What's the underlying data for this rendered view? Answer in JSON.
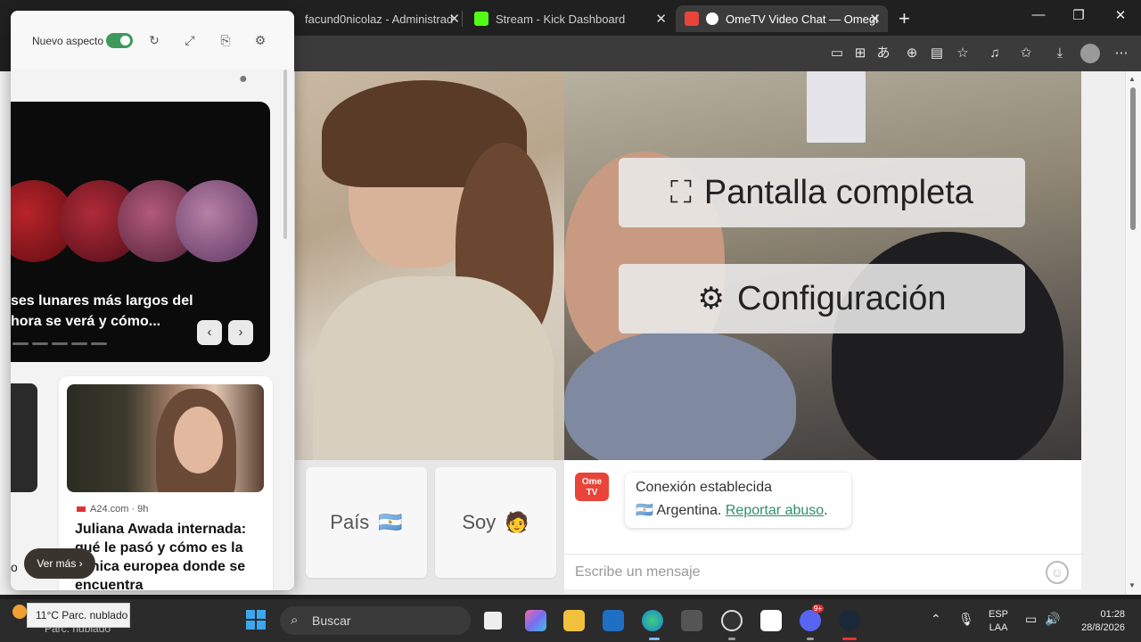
{
  "browser": {
    "tabs": [
      {
        "title": "facund0nicolaz - Administrad",
        "active": false
      },
      {
        "title": "Stream - Kick Dashboard",
        "active": false
      },
      {
        "title": "OmeTV Video Chat — Omegl",
        "active": true
      }
    ],
    "new_tab_label": "+",
    "window_controls": {
      "minimize": "—",
      "restore": "❐",
      "close": "✕"
    }
  },
  "sidebar": {
    "toggle_label": "Nuevo aspecto",
    "toggle_on": true,
    "header_icons": [
      "refresh-icon",
      "expand-icon",
      "share-icon",
      "gear-icon"
    ],
    "hero": {
      "title_line1": "ses lunares más largos del",
      "title_line2": "hora se verá y cómo...",
      "prev": "‹",
      "next": "›"
    },
    "news_card": {
      "source": "A24.com · 9h",
      "title": "Juliana Awada internada: qué le pasó y cómo es la clínica europea donde se encuentra"
    },
    "ver_mas": "Ver más",
    "side_letter": "o"
  },
  "video": {
    "fullscreen_label": "Pantalla completa",
    "settings_label": "Configuración"
  },
  "filters": {
    "country_label": "País",
    "country_flag": "🇦🇷",
    "gender_label": "Soy",
    "gender_emoji": "🧑"
  },
  "chat": {
    "logo_line1": "Ome",
    "logo_line2": "TV",
    "status": "Conexión establecida",
    "country_flag": "🇦🇷",
    "country": "Argentina.",
    "report_link": "Reportar abuso",
    "report_end": ".",
    "input_placeholder": "Escribe un mensaje"
  },
  "taskbar": {
    "weather_text": "Parc. nublado",
    "weather_tooltip": "11°C Parc. nublado",
    "search_placeholder": "Buscar",
    "notification_badge": "9+",
    "language_line1": "ESP",
    "language_line2": "LAA",
    "time": "01:28",
    "date": "28/8/2026"
  },
  "colors": {
    "toggle_green": "#3d9a5c",
    "report_link": "#2f8f6a",
    "ometv_logo": "#e8443a"
  }
}
